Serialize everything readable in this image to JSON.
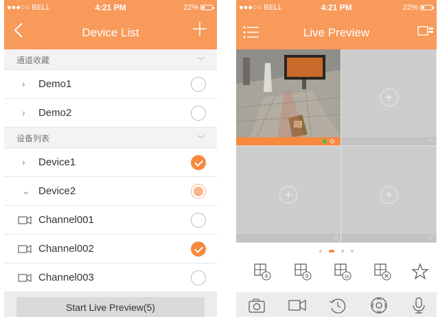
{
  "status_bar": {
    "carrier": "●●●○○ BELL",
    "time": "4:21 PM",
    "battery": "22%"
  },
  "left": {
    "nav_title": "Device List",
    "back_icon": "chevron-left-icon",
    "add_icon": "plus-icon",
    "sections": [
      {
        "title": "通道收藏"
      },
      {
        "title": "设备列表"
      }
    ],
    "favorites": [
      {
        "label": "Demo1",
        "checked": "none"
      },
      {
        "label": "Demo2",
        "checked": "none"
      }
    ],
    "devices": [
      {
        "label": "Device1",
        "checked": "full"
      },
      {
        "label": "Device2",
        "checked": "partial"
      }
    ],
    "channels": [
      {
        "label": "Channel001",
        "checked": "none"
      },
      {
        "label": "Channel002",
        "checked": "full"
      },
      {
        "label": "Channel003",
        "checked": "none"
      }
    ],
    "start_button": "Start Live Preview(5)"
  },
  "right": {
    "nav_title": "Live Preview",
    "menu_icon": "list-menu-icon",
    "right_icon": "channel-switch-icon",
    "page_index": "2 of 4",
    "layout_buttons": [
      {
        "name": "layout-4",
        "badge": "4"
      },
      {
        "name": "layout-9",
        "badge": "9"
      },
      {
        "name": "layout-16",
        "badge": "16"
      },
      {
        "name": "layout-close",
        "badge": "×"
      },
      {
        "name": "favorite",
        "badge": ""
      }
    ],
    "toolbar": [
      "camera-snapshot-icon",
      "record-icon",
      "playback-icon",
      "ptz-icon",
      "microphone-icon"
    ]
  },
  "colors": {
    "accent": "#f79a5a",
    "check": "#f7893f"
  }
}
